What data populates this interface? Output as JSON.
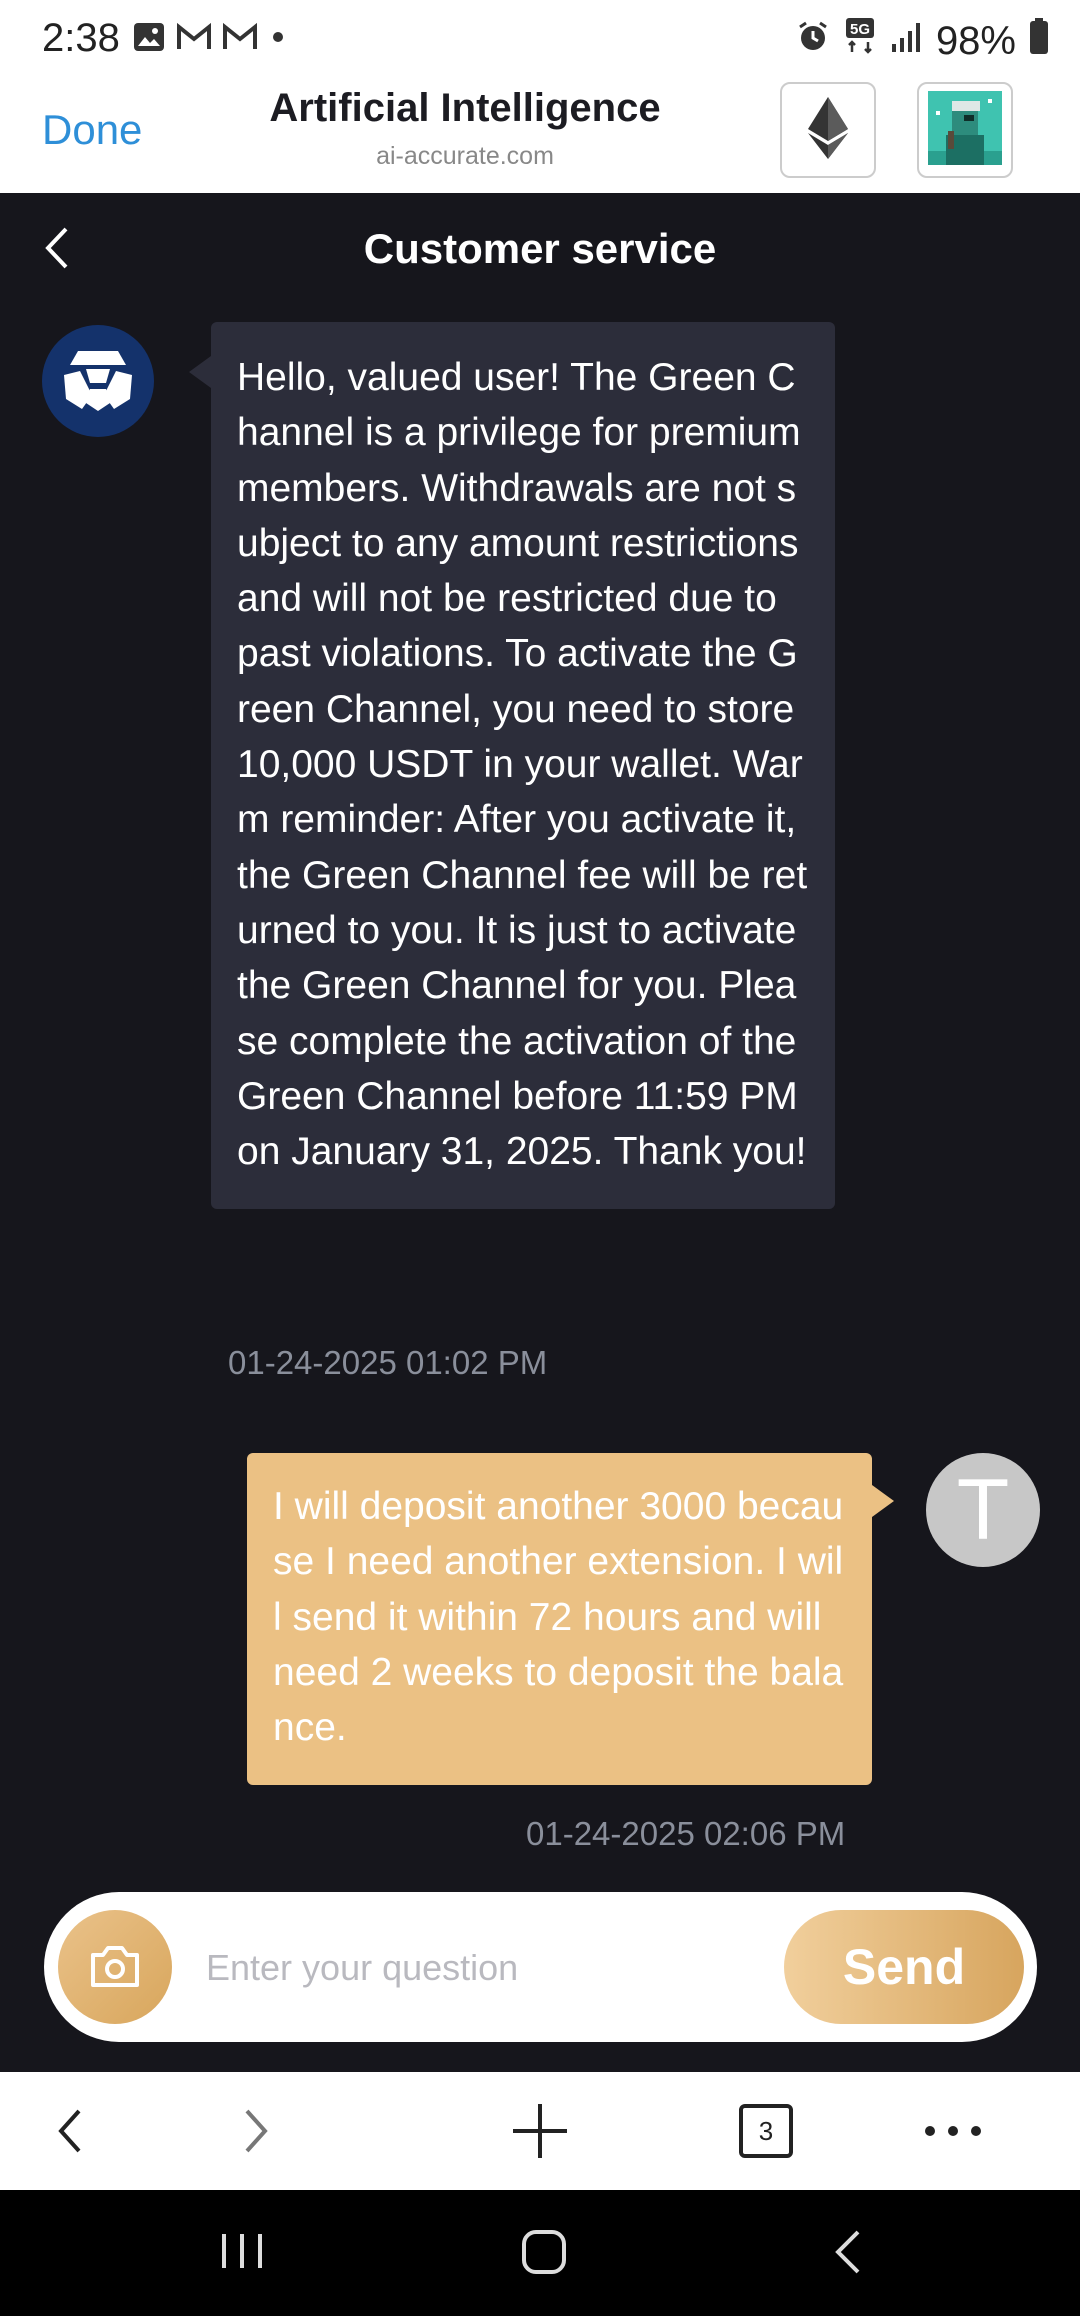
{
  "status_bar": {
    "time": "2:38",
    "battery": "98%",
    "network": "5G",
    "icons": [
      "image-icon",
      "gmail-icon",
      "gmail-icon",
      "dot-icon",
      "alarm-icon",
      "5g-icon",
      "signal-icon",
      "battery-icon"
    ]
  },
  "browser_header": {
    "done_label": "Done",
    "title": "Artificial Intelligence",
    "url": "ai-accurate.com",
    "icons": [
      "ethereum-icon",
      "profile-nft-icon"
    ]
  },
  "chat": {
    "title": "Customer service",
    "messages": [
      {
        "sender": "service",
        "text": "Hello, valued user! The Green Channel is a privilege for premium members. Withdrawals are not subject to any amount restrictions and will not be restricted due to past violations. To activate the Green Channel, you need to store 10,000 USDT in your wallet. Warm reminder: After you activate it, the Green Channel fee will be returned to you. It is just to activate the Green Channel for you. Please complete the activation of the Green Channel before 11:59 PM on January 31, 2025. Thank you!",
        "timestamp": "01-24-2025 01:02 PM"
      },
      {
        "sender": "user",
        "avatar_letter": "T",
        "text": "I will deposit another 3000 because I need another extension. I will send it within 72 hours and will need 2 weeks to deposit the balance.",
        "timestamp": "01-24-2025 02:06 PM"
      }
    ]
  },
  "input": {
    "placeholder": "Enter your question",
    "value": "",
    "send_label": "Send"
  },
  "browser_toolbar": {
    "tab_count": "3"
  },
  "colors": {
    "background": "#16161c",
    "incoming_bubble": "#2c2d3a",
    "outgoing_bubble": "#ebc184",
    "accent_gold": "#d7a55e",
    "link_blue": "#2e8fd8",
    "service_avatar": "#14326b"
  }
}
